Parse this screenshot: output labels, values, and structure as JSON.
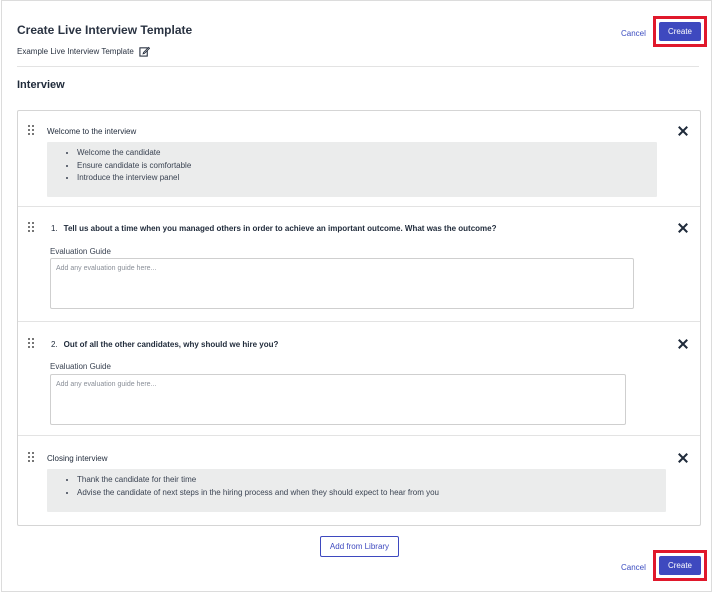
{
  "header": {
    "title": "Create Live Interview Template",
    "template_name": "Example Live Interview Template",
    "cancel_label": "Cancel",
    "create_label": "Create"
  },
  "section": {
    "heading": "Interview"
  },
  "items": [
    {
      "type": "section",
      "title": "Welcome to the interview",
      "notes": [
        "Welcome the candidate",
        "Ensure candidate is comfortable",
        "Introduce the interview panel"
      ]
    },
    {
      "type": "question",
      "number": "1.",
      "text": "Tell us about a time when you managed others in order to achieve an important outcome. What was the outcome?",
      "eval_label": "Evaluation Guide",
      "eval_placeholder": "Add any evaluation guide here..."
    },
    {
      "type": "question",
      "number": "2.",
      "text": "Out of all the other candidates, why should we hire you?",
      "eval_label": "Evaluation Guide",
      "eval_placeholder": "Add any evaluation guide here..."
    },
    {
      "type": "section",
      "title": "Closing interview",
      "notes": [
        "Thank the candidate for their time",
        "Advise the candidate of next steps in the hiring process and when they should expect to hear from you"
      ]
    }
  ],
  "footer": {
    "add_library_label": "Add from Library",
    "cancel_label": "Cancel",
    "create_label": "Create"
  },
  "colors": {
    "accent": "#3e49bf",
    "highlight": "#e0182b",
    "notes_bg": "#ebecec"
  },
  "icons": {
    "edit": "edit-icon",
    "drag": "drag-handle-icon",
    "close": "close-icon"
  }
}
